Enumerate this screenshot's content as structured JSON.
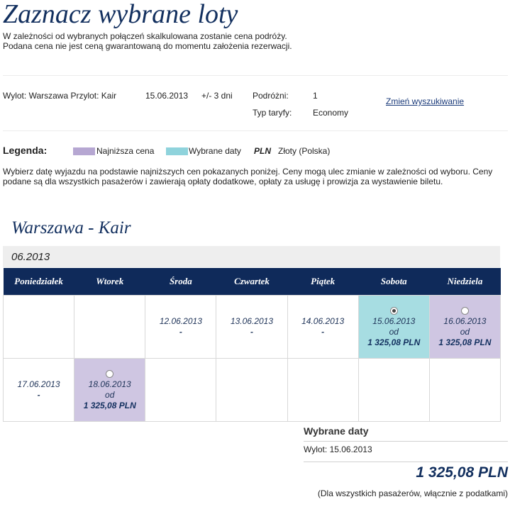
{
  "page": {
    "title": "Zaznacz wybrane loty",
    "intro_line1": "W zależności od wybranych połączeń skalkulowana zostanie cena podróży.",
    "intro_line2": "Podana cena nie jest ceną gwarantowaną do momentu założenia rezerwacji."
  },
  "search": {
    "route": "Wylot: Warszawa Przylot: Kair",
    "date": "15.06.2013",
    "flex": "+/- 3 dni",
    "travelers_label": "Podróżni:",
    "travelers_value": "1",
    "fare_label": "Typ taryfy:",
    "fare_value": "Economy",
    "change_link": "Zmień wyszukiwanie"
  },
  "legend": {
    "title": "Legenda:",
    "lowest_label": "Najniższa cena",
    "lowest_color": "#b6a7d2",
    "selected_label": "Wybrane daty",
    "selected_color": "#8fd3dc",
    "currency_code": "PLN",
    "currency_name": "Złoty (Polska)"
  },
  "description": "Wybierz datę wyjazdu na podstawie najniższych cen pokazanych poniżej. Ceny mogą ulec zmianie w zależności od wyboru. Ceny podane są dla wszystkich pasażerów i zawierają opłaty dodatkowe, opłaty za usługę i prowizja za wystawienie biletu.",
  "route_title": "Warszawa - Kair",
  "month": "06.2013",
  "calendar": {
    "days": [
      "Poniedziałek",
      "Wtorek",
      "Środa",
      "Czwartek",
      "Piątek",
      "Sobota",
      "Niedziela"
    ],
    "weeks": [
      [
        {
          "empty": true
        },
        {
          "empty": true
        },
        {
          "date": "12.06.2013",
          "dash": "-"
        },
        {
          "date": "13.06.2013",
          "dash": "-"
        },
        {
          "date": "14.06.2013",
          "dash": "-"
        },
        {
          "date": "15.06.2013",
          "from": "od",
          "price": "1 325,08 PLN",
          "state": "selected",
          "radio": true,
          "checked": true
        },
        {
          "date": "16.06.2013",
          "from": "od",
          "price": "1 325,08 PLN",
          "state": "lowest",
          "radio": true,
          "checked": false
        }
      ],
      [
        {
          "date": "17.06.2013",
          "dash": "-"
        },
        {
          "date": "18.06.2013",
          "from": "od",
          "price": "1 325,08 PLN",
          "state": "lowest",
          "radio": true,
          "checked": false
        },
        {
          "empty": true
        },
        {
          "empty": true
        },
        {
          "empty": true
        },
        {
          "empty": true
        },
        {
          "empty": true
        }
      ]
    ]
  },
  "summary": {
    "title": "Wybrane daty",
    "departure": "Wylot: 15.06.2013",
    "total": "1 325,08 PLN",
    "note": "(Dla wszystkich pasażerów, włącznie z podatkami)"
  }
}
